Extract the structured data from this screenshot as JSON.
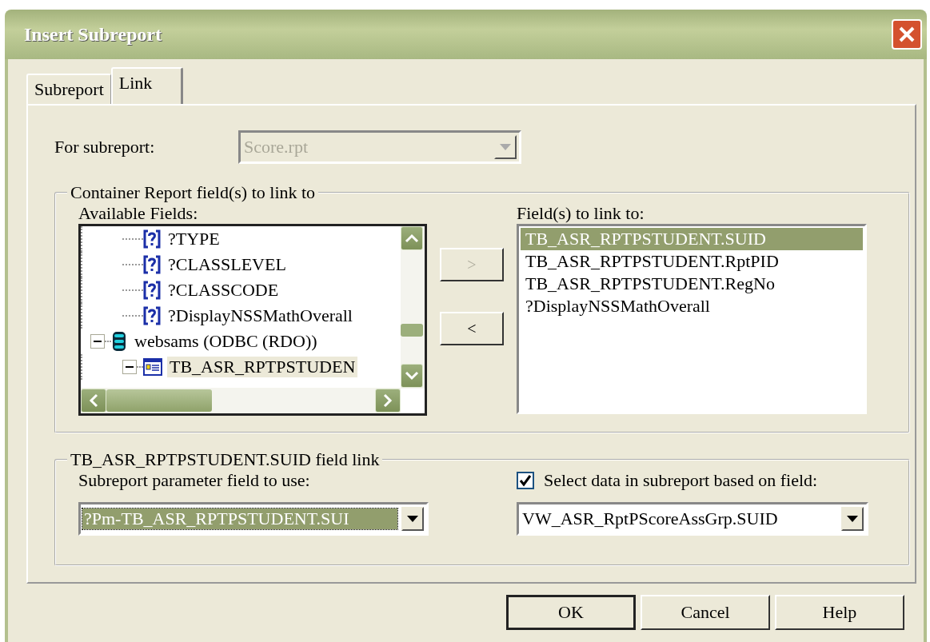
{
  "window": {
    "title": "Insert Subreport"
  },
  "tabs": [
    {
      "label": "Subreport",
      "selected": false
    },
    {
      "label": "Link",
      "selected": true
    }
  ],
  "for_subreport": {
    "label": "For subreport:",
    "value": "Score.rpt",
    "disabled": true
  },
  "container_group": {
    "title": "Container Report field(s) to link to",
    "available_fields": {
      "label": "Available Fields:",
      "items": [
        {
          "kind": "parameter",
          "label": "?TYPE",
          "selected": false
        },
        {
          "kind": "parameter",
          "label": "?CLASSLEVEL",
          "selected": false
        },
        {
          "kind": "parameter",
          "label": "?CLASSCODE",
          "selected": false
        },
        {
          "kind": "parameter",
          "label": "?DisplayNSSMathOverall",
          "selected": false
        },
        {
          "kind": "database",
          "label": "websams (ODBC (RDO))",
          "selected": false,
          "expanded": true,
          "children": [
            {
              "kind": "table",
              "label": "TB_ASR_RPTPSTUDEN",
              "selected": true,
              "expanded": true
            }
          ]
        }
      ]
    },
    "add_button": {
      "label": ">",
      "disabled": true
    },
    "remove_button": {
      "label": "<",
      "disabled": false
    },
    "linked_fields": {
      "label": "Field(s) to link to:",
      "items": [
        {
          "label": "TB_ASR_RPTPSTUDENT.SUID",
          "selected": true
        },
        {
          "label": "TB_ASR_RPTPSTUDENT.RptPID",
          "selected": false
        },
        {
          "label": "TB_ASR_RPTPSTUDENT.RegNo",
          "selected": false
        },
        {
          "label": "?DisplayNSSMathOverall",
          "selected": false
        }
      ]
    }
  },
  "field_link_group": {
    "title": "TB_ASR_RPTPSTUDENT.SUID field link",
    "parameter_field": {
      "label": "Subreport parameter field to use:",
      "value": "?Pm-TB_ASR_RPTPSTUDENT.SUI",
      "text_selected": true
    },
    "select_data": {
      "label": "Select data in subreport based on field:",
      "checked": true
    },
    "data_field": {
      "value": "VW_ASR_RptPScoreAssGrp.SUID"
    }
  },
  "buttons": [
    {
      "label": "OK",
      "default": true
    },
    {
      "label": "Cancel",
      "default": false
    },
    {
      "label": "Help",
      "default": false
    }
  ]
}
